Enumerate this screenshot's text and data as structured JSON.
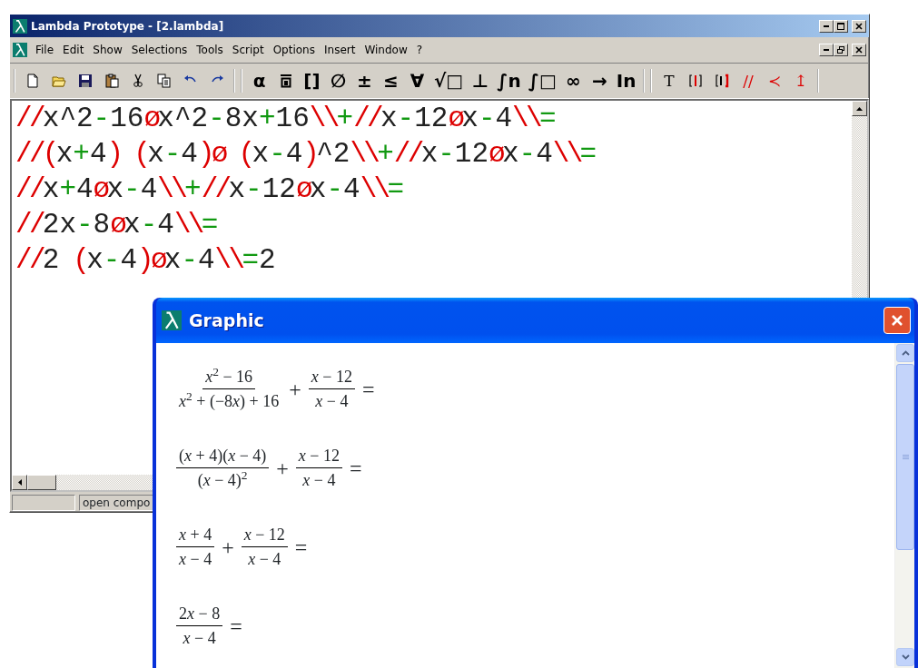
{
  "main_window": {
    "title": "Lambda Prototype - [2.lambda]",
    "menu": [
      "File",
      "Edit",
      "Show",
      "Selections",
      "Tools",
      "Script",
      "Options",
      "Insert",
      "Window",
      "?"
    ],
    "toolbars": [
      [
        {
          "kind": "new"
        },
        {
          "kind": "open"
        },
        {
          "kind": "save"
        },
        {
          "kind": "paste"
        },
        {
          "kind": "cut"
        },
        {
          "kind": "copy"
        },
        {
          "kind": "undo"
        },
        {
          "kind": "redo"
        }
      ],
      [
        {
          "kind": "glyph",
          "text": "α"
        },
        {
          "kind": "overline-box"
        },
        {
          "kind": "glyph",
          "text": "[]"
        },
        {
          "kind": "glyph",
          "text": "∅"
        },
        {
          "kind": "glyph",
          "text": "±"
        },
        {
          "kind": "glyph",
          "text": "≤"
        },
        {
          "kind": "glyph",
          "text": "∀"
        },
        {
          "kind": "glyph",
          "text": "√□"
        },
        {
          "kind": "glyph",
          "text": "⊥"
        },
        {
          "kind": "glyph",
          "text": "∫n"
        },
        {
          "kind": "glyph",
          "text": "∫□"
        },
        {
          "kind": "glyph",
          "text": "∞"
        },
        {
          "kind": "glyph",
          "text": "→"
        },
        {
          "kind": "glyph",
          "text": "In"
        }
      ],
      [
        {
          "kind": "glyph",
          "text": "T",
          "color": "#000000"
        },
        {
          "kind": "bracket-bar"
        },
        {
          "kind": "bracket-bold"
        },
        {
          "kind": "glyph",
          "text": "//",
          "color": "#dd0000"
        },
        {
          "kind": "glyph",
          "text": "≺",
          "color": "#dd0000"
        },
        {
          "kind": "glyph",
          "text": "↥",
          "color": "#dd0000"
        }
      ]
    ],
    "lines": [
      [
        {
          "kind": "delimiter",
          "text": "//"
        },
        {
          "kind": "term",
          "text": "x^2"
        },
        {
          "kind": "operator",
          "text": "-"
        },
        {
          "kind": "term",
          "text": "16"
        },
        {
          "kind": "delimiter",
          "text": "ø"
        },
        {
          "kind": "term",
          "text": "x^2"
        },
        {
          "kind": "operator",
          "text": "-"
        },
        {
          "kind": "term",
          "text": "8x"
        },
        {
          "kind": "operator",
          "text": "+"
        },
        {
          "kind": "term",
          "text": "16"
        },
        {
          "kind": "delimiter",
          "text": "\\\\"
        },
        {
          "kind": "operator",
          "text": "+"
        },
        {
          "kind": "delimiter",
          "text": "//"
        },
        {
          "kind": "term",
          "text": "x"
        },
        {
          "kind": "operator",
          "text": "-"
        },
        {
          "kind": "term",
          "text": "12"
        },
        {
          "kind": "delimiter",
          "text": "ø"
        },
        {
          "kind": "term",
          "text": "x"
        },
        {
          "kind": "operator",
          "text": "-"
        },
        {
          "kind": "term",
          "text": "4"
        },
        {
          "kind": "delimiter",
          "text": "\\\\"
        },
        {
          "kind": "operator",
          "text": "="
        }
      ],
      [
        {
          "kind": "delimiter",
          "text": "//("
        },
        {
          "kind": "term",
          "text": "x"
        },
        {
          "kind": "operator",
          "text": "+"
        },
        {
          "kind": "term",
          "text": "4"
        },
        {
          "kind": "delimiter",
          "text": ") ("
        },
        {
          "kind": "term",
          "text": "x"
        },
        {
          "kind": "operator",
          "text": "-"
        },
        {
          "kind": "term",
          "text": "4"
        },
        {
          "kind": "delimiter",
          "text": ")ø ("
        },
        {
          "kind": "term",
          "text": "x"
        },
        {
          "kind": "operator",
          "text": "-"
        },
        {
          "kind": "term",
          "text": "4"
        },
        {
          "kind": "delimiter",
          "text": ")"
        },
        {
          "kind": "term",
          "text": "^2"
        },
        {
          "kind": "delimiter",
          "text": "\\\\"
        },
        {
          "kind": "operator",
          "text": "+"
        },
        {
          "kind": "delimiter",
          "text": "//"
        },
        {
          "kind": "term",
          "text": "x"
        },
        {
          "kind": "operator",
          "text": "-"
        },
        {
          "kind": "term",
          "text": "12"
        },
        {
          "kind": "delimiter",
          "text": "ø"
        },
        {
          "kind": "term",
          "text": "x"
        },
        {
          "kind": "operator",
          "text": "-"
        },
        {
          "kind": "term",
          "text": "4"
        },
        {
          "kind": "delimiter",
          "text": "\\\\"
        },
        {
          "kind": "operator",
          "text": "="
        }
      ],
      [
        {
          "kind": "delimiter",
          "text": "//"
        },
        {
          "kind": "term",
          "text": "x"
        },
        {
          "kind": "operator",
          "text": "+"
        },
        {
          "kind": "term",
          "text": "4"
        },
        {
          "kind": "delimiter",
          "text": "ø"
        },
        {
          "kind": "term",
          "text": "x"
        },
        {
          "kind": "operator",
          "text": "-"
        },
        {
          "kind": "term",
          "text": "4"
        },
        {
          "kind": "delimiter",
          "text": "\\\\"
        },
        {
          "kind": "operator",
          "text": "+"
        },
        {
          "kind": "delimiter",
          "text": "//"
        },
        {
          "kind": "term",
          "text": "x"
        },
        {
          "kind": "operator",
          "text": "-"
        },
        {
          "kind": "term",
          "text": "12"
        },
        {
          "kind": "delimiter",
          "text": "ø"
        },
        {
          "kind": "term",
          "text": "x"
        },
        {
          "kind": "operator",
          "text": "-"
        },
        {
          "kind": "term",
          "text": "4"
        },
        {
          "kind": "delimiter",
          "text": "\\\\"
        },
        {
          "kind": "operator",
          "text": "="
        }
      ],
      [
        {
          "kind": "delimiter",
          "text": "//"
        },
        {
          "kind": "term",
          "text": "2x"
        },
        {
          "kind": "operator",
          "text": "-"
        },
        {
          "kind": "term",
          "text": "8"
        },
        {
          "kind": "delimiter",
          "text": "ø"
        },
        {
          "kind": "term",
          "text": "x"
        },
        {
          "kind": "operator",
          "text": "-"
        },
        {
          "kind": "term",
          "text": "4"
        },
        {
          "kind": "delimiter",
          "text": "\\\\"
        },
        {
          "kind": "operator",
          "text": "="
        }
      ],
      [
        {
          "kind": "delimiter",
          "text": "//"
        },
        {
          "kind": "term",
          "text": "2"
        },
        {
          "kind": "delimiter",
          "text": " ("
        },
        {
          "kind": "term",
          "text": "x"
        },
        {
          "kind": "operator",
          "text": "-"
        },
        {
          "kind": "term",
          "text": "4"
        },
        {
          "kind": "delimiter",
          "text": ")ø"
        },
        {
          "kind": "term",
          "text": "x"
        },
        {
          "kind": "operator",
          "text": "-"
        },
        {
          "kind": "term",
          "text": "4"
        },
        {
          "kind": "delimiter",
          "text": "\\\\"
        },
        {
          "kind": "operator",
          "text": "="
        },
        {
          "kind": "term",
          "text": "2"
        }
      ]
    ],
    "status_bar": {
      "text": "open compo"
    }
  },
  "graphic_window": {
    "title": "Graphic",
    "rows": [
      [
        {
          "kind": "fraction",
          "numerator": "x$^{2}$ − 16",
          "denominator": "x$^{2}$ + (−8x) + 16"
        },
        {
          "kind": "operator",
          "text": "+"
        },
        {
          "kind": "fraction",
          "numerator": "x − 12",
          "denominator": "x − 4"
        },
        {
          "kind": "operator",
          "text": "="
        }
      ],
      [
        {
          "kind": "fraction",
          "numerator": "(x + 4)(x − 4)",
          "denominator": "(x − 4)$^{2}$"
        },
        {
          "kind": "operator",
          "text": "+"
        },
        {
          "kind": "fraction",
          "numerator": "x − 12",
          "denominator": "x − 4"
        },
        {
          "kind": "operator",
          "text": "="
        }
      ],
      [
        {
          "kind": "fraction",
          "numerator": "x + 4",
          "denominator": "x − 4"
        },
        {
          "kind": "operator",
          "text": "+"
        },
        {
          "kind": "fraction",
          "numerator": "x − 12",
          "denominator": "x − 4"
        },
        {
          "kind": "operator",
          "text": "="
        }
      ],
      [
        {
          "kind": "fraction",
          "numerator": "2x − 8",
          "denominator": "x − 4"
        },
        {
          "kind": "operator",
          "text": "="
        }
      ]
    ]
  }
}
